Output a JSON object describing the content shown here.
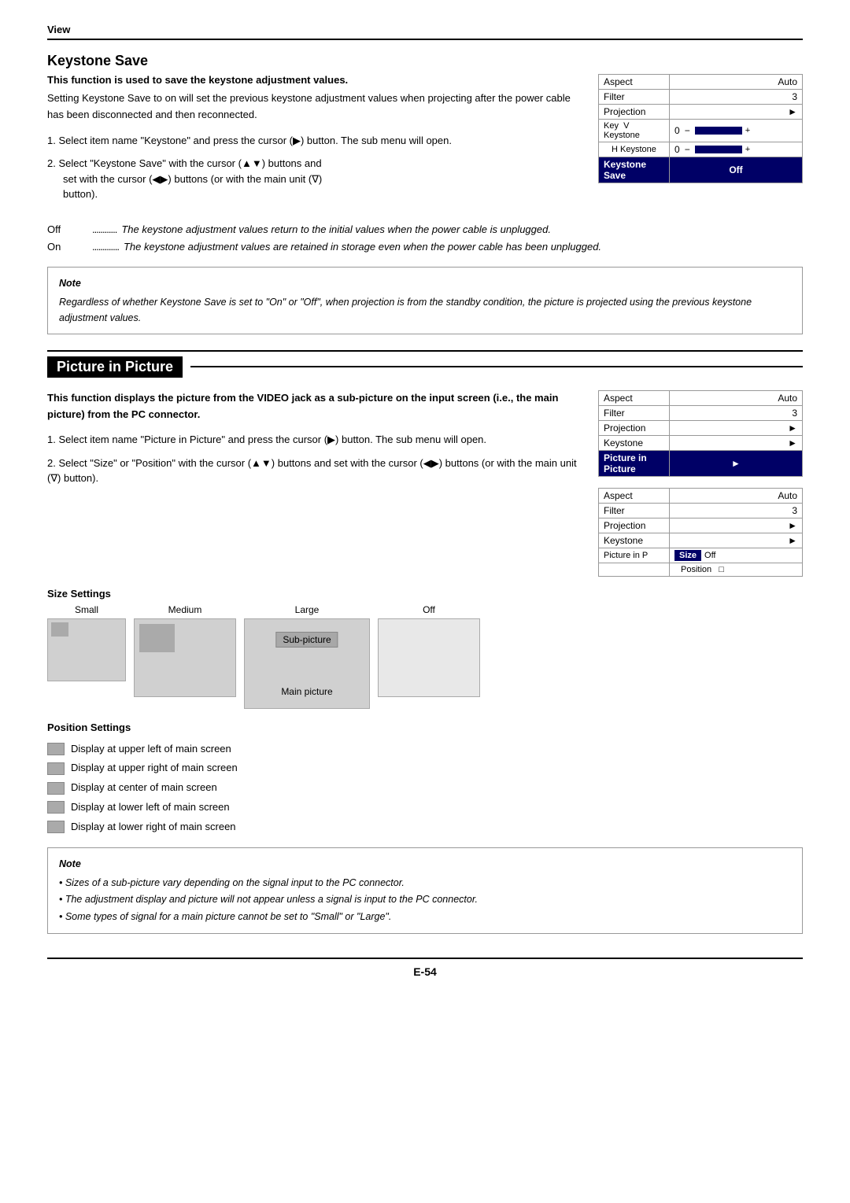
{
  "view_header": "View",
  "keystone_save": {
    "title": "Keystone Save",
    "bold_desc": "This function is used to save the keystone adjustment values.",
    "intro": "Setting Keystone Save to on will set the previous keystone adjustment values when projecting after the power cable has been disconnected and then reconnected.",
    "step1": "1. Select item name \"Keystone\" and press the cursor (▶) button. The sub menu will open.",
    "step2_a": "2. Select \"Keystone Save\" with the cursor (▲▼) buttons and",
    "step2_b": "set with the cursor (◀▶) buttons (or with the main unit (∇)",
    "step2_c": "button).",
    "off_label": "Off",
    "off_dots": "...............",
    "off_desc": "The keystone adjustment values return to the initial values when the power cable is unplugged.",
    "on_label": "On",
    "on_dots": "................",
    "on_desc": "The keystone adjustment values are retained in storage even when the power cable has been unplugged.",
    "note_title": "Note",
    "note_text": "Regardless of whether Keystone Save is set to \"On\" or \"Off\", when projection is from the standby condition, the picture is projected using the previous keystone adjustment values.",
    "menu1": {
      "rows": [
        {
          "label": "Aspect",
          "value": "Auto",
          "type": "normal"
        },
        {
          "label": "Filter",
          "value": "3",
          "type": "normal"
        },
        {
          "label": "Projection",
          "value": "▶",
          "type": "normal"
        },
        {
          "label": "Key  V Keystone",
          "value": "0",
          "type": "slider"
        },
        {
          "label": "",
          "value": "H Keystone",
          "sub_val": "0",
          "type": "slider2"
        },
        {
          "label": "Keystone Save",
          "value": "Off",
          "type": "highlighted"
        }
      ]
    }
  },
  "picture_in_picture": {
    "title": "Picture in Picture",
    "bold_desc": "This function displays the picture from the VIDEO jack as a sub-picture on the input screen (i.e., the main picture) from the PC connector.",
    "step1": "1. Select item name \"Picture in Picture\" and press the cursor (▶) button. The sub menu will open.",
    "step2": "2. Select \"Size\" or \"Position\" with the cursor (▲▼) buttons and set with the cursor (◀▶) buttons (or with the main unit (∇) button).",
    "size_settings_title": "Size Settings",
    "size_labels": [
      "Small",
      "Medium",
      "Large",
      "Off"
    ],
    "sub_label_sub": "Sub-picture",
    "sub_label_main": "Main picture",
    "position_settings_title": "Position Settings",
    "positions": [
      "Display at upper left of main screen",
      "Display at upper right of main screen",
      "Display at center of main screen",
      "Display at lower left of main screen",
      "Display at lower right of main screen"
    ],
    "note_title": "Note",
    "note_bullets": [
      "• Sizes of a sub-picture vary depending on the signal input to the PC connector.",
      "• The adjustment display and picture will not appear unless a signal is input to the PC connector.",
      "• Some types of signal for a main picture cannot be set to \"Small\" or \"Large\"."
    ],
    "menu2": {
      "rows": [
        {
          "label": "Aspect",
          "value": "Auto"
        },
        {
          "label": "Filter",
          "value": "3"
        },
        {
          "label": "Projection",
          "value": "▶"
        },
        {
          "label": "Keystone",
          "value": "▶"
        },
        {
          "label": "Picture in Picture",
          "value": "▶",
          "highlighted": true
        }
      ]
    },
    "menu3": {
      "rows": [
        {
          "label": "Aspect",
          "value": "Auto"
        },
        {
          "label": "Filter",
          "value": "3"
        },
        {
          "label": "Projection",
          "value": "▶"
        },
        {
          "label": "Keystone",
          "value": "▶"
        },
        {
          "label": "Picture in P",
          "value": "Size",
          "sub_val": "Off",
          "highlighted": true
        },
        {
          "label": "",
          "value": "Position",
          "sub_val": "□"
        }
      ]
    }
  },
  "page_number": "E-54"
}
